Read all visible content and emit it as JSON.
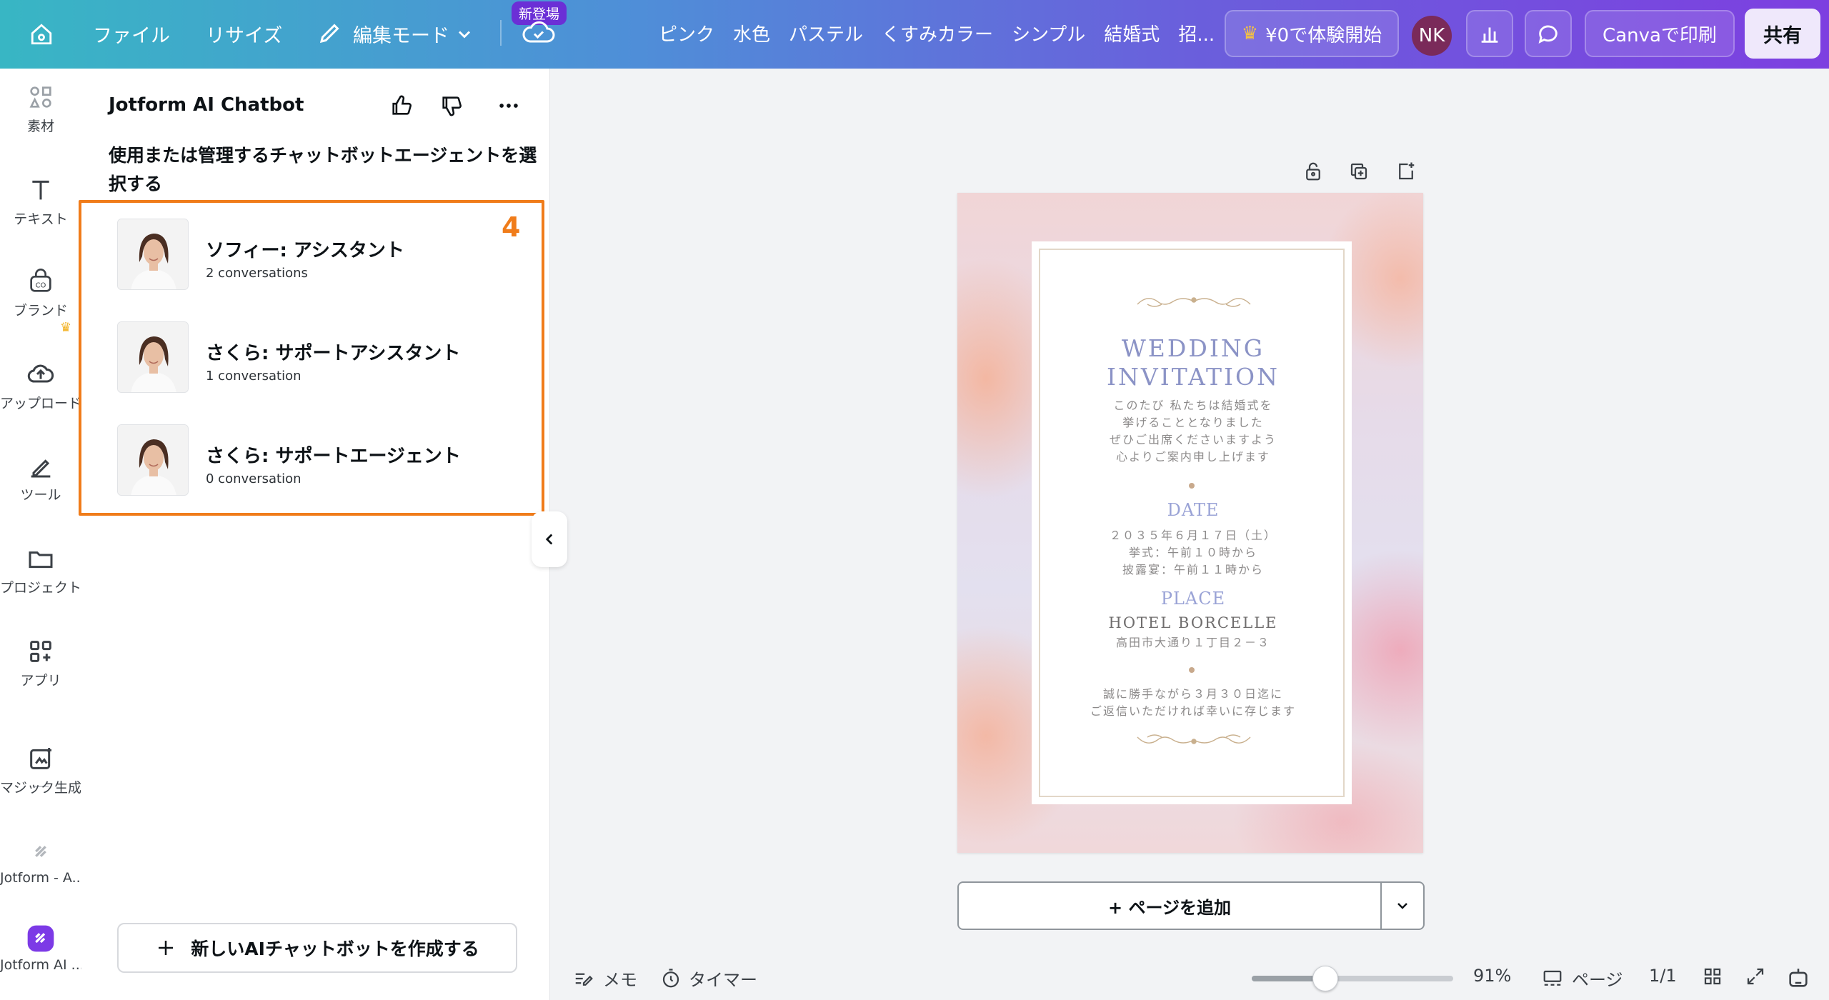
{
  "topbar": {
    "file": "ファイル",
    "resize": "リサイズ",
    "edit_mode": "編集モード",
    "new_badge": "新登場",
    "tags": [
      "ピンク",
      "水色",
      "パステル",
      "くすみカラー",
      "シンプル",
      "結婚式",
      "招..."
    ],
    "trial": "¥0で体験開始",
    "avatar": "NK",
    "print": "Canvaで印刷",
    "share": "共有"
  },
  "rail": {
    "items": [
      {
        "label": "素材",
        "icon": "elements-icon"
      },
      {
        "label": "テキスト",
        "icon": "text-icon"
      },
      {
        "label": "ブランド",
        "icon": "brand-icon"
      },
      {
        "label": "アップロード",
        "icon": "upload-icon"
      },
      {
        "label": "ツール",
        "icon": "tools-icon"
      },
      {
        "label": "プロジェクト",
        "icon": "folder-icon"
      },
      {
        "label": "アプリ",
        "icon": "apps-icon"
      },
      {
        "label": "マジック生成",
        "icon": "magic-icon"
      },
      {
        "label": "Jotform - A...",
        "icon": "jotform-icon"
      },
      {
        "label": "Jotform AI ...",
        "icon": "jotform-ai-icon"
      }
    ]
  },
  "panel": {
    "title": "Jotform AI Chatbot",
    "subtitle": "使用または管理するチャットボットエージェントを選択する",
    "highlight_number": "4",
    "bots": [
      {
        "name": "ソフィー: アシスタント",
        "count": "2 conversations"
      },
      {
        "name": "さくら: サポートアシスタント",
        "count": "1 conversation"
      },
      {
        "name": "さくら: サポートエージェント",
        "count": "0 conversation"
      }
    ],
    "create_button": "新しいAIチャットボットを作成する"
  },
  "invitation": {
    "title_line1": "WEDDING",
    "title_line2": "INVITATION",
    "intro": [
      "このたび 私たちは結婚式を",
      "挙げることとなりました",
      "ぜひご出席くださいますよう",
      "心よりご案内申し上げます"
    ],
    "date_head": "DATE",
    "date_lines": [
      "２０３５年６月１７日（土）",
      "挙式：午前１０時から",
      "披露宴：午前１１時から"
    ],
    "place_head": "PLACE",
    "hotel": "HOTEL BORCELLE",
    "address": "高田市大通り１丁目２－３",
    "rsvp": [
      "誠に勝手ながら３月３０日迄に",
      "ご返信いただければ幸いに存じます"
    ]
  },
  "canvas": {
    "add_page": "+ ページを追加"
  },
  "footer": {
    "notes": "メモ",
    "timer": "タイマー",
    "zoom_level": 0.91,
    "zoom": "91%",
    "pages": "ページ",
    "page_count": "1/1"
  },
  "colors": {
    "highlight": "#f07c1a",
    "wedding_title": "#8b93c6"
  }
}
